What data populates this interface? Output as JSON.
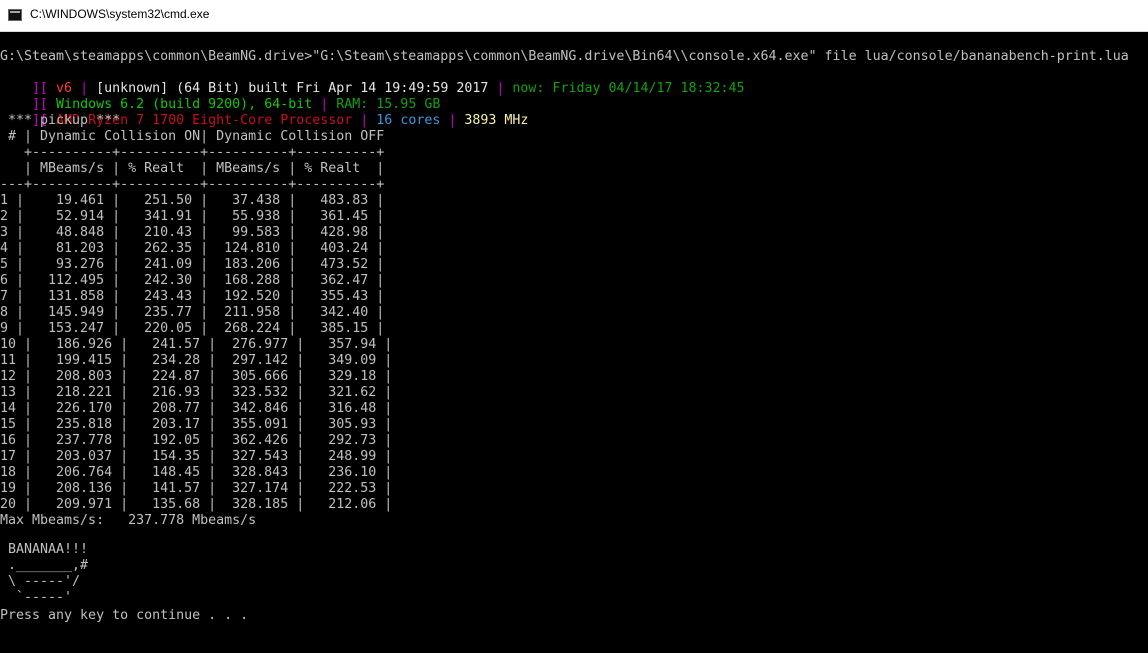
{
  "window": {
    "title": "C:\\WINDOWS\\system32\\cmd.exe",
    "minimize": "—",
    "maximize": "☐",
    "close": "✕"
  },
  "console": {
    "command": "G:\\Steam\\steamapps\\common\\BeamNG.drive>\"G:\\Steam\\steamapps\\common\\BeamNG.drive\\Bin64\\\\console.x64.exe\" file lua/console/bananabench-print.lua",
    "info1": {
      "prefix": "][",
      "version": " v6",
      "sep": " | ",
      "build": "[unknown] (64 Bit) built Fri Apr 14 19:49:59 2017",
      "sep2": " | ",
      "now": "now: Friday 04/14/17 18:32:45"
    },
    "info2": {
      "prefix": "][",
      "os": " Windows 6.2 (build 9200), 64-bit",
      "sep": " | ",
      "ram": "RAM: 15.95 GB"
    },
    "info3": {
      "prefix": "][",
      "cpu": " AMD Ryzen 7 1700 Eight-Core Processor",
      "sep": " | ",
      "cores": "16 cores",
      "sep2": " | ",
      "mhz": "3893 MHz"
    },
    "table_lines": [
      " *** pickup ***",
      " # | Dynamic Collision ON| Dynamic Collision OFF",
      "   +----------+----------+----------+----------+",
      "   | MBeams/s | % Realt  | MBeams/s | % Realt  |",
      "---+----------+----------+----------+----------+",
      "1 |    19.461 |   251.50 |   37.438 |   483.83 |",
      "2 |    52.914 |   341.91 |   55.938 |   361.45 |",
      "3 |    48.848 |   210.43 |   99.583 |   428.98 |",
      "4 |    81.203 |   262.35 |  124.810 |   403.24 |",
      "5 |    93.276 |   241.09 |  183.206 |   473.52 |",
      "6 |   112.495 |   242.30 |  168.288 |   362.47 |",
      "7 |   131.858 |   243.43 |  192.520 |   355.43 |",
      "8 |   145.949 |   235.77 |  211.958 |   342.40 |",
      "9 |   153.247 |   220.05 |  268.224 |   385.15 |",
      "10 |   186.926 |   241.57 |  276.977 |   357.94 |",
      "11 |   199.415 |   234.28 |  297.142 |   349.09 |",
      "12 |   208.803 |   224.87 |  305.666 |   329.18 |",
      "13 |   218.221 |   216.93 |  323.532 |   321.62 |",
      "14 |   226.170 |   208.77 |  342.846 |   316.48 |",
      "15 |   235.818 |   203.17 |  355.091 |   305.93 |",
      "16 |   237.778 |   192.05 |  362.426 |   292.73 |",
      "17 |   203.037 |   154.35 |  327.543 |   248.99 |",
      "18 |   206.764 |   148.45 |  328.843 |   236.10 |",
      "19 |   208.136 |   141.57 |  327.174 |   222.53 |",
      "20 |   209.971 |   135.68 |  328.185 |   212.06 |",
      "Max Mbeams/s:   237.778 Mbeams/s"
    ],
    "banana_lines": [
      " BANANAA!!!",
      " ._______,#",
      " \\ -----'/",
      "  `-----'"
    ],
    "prompt": "Press any key to continue . . ."
  }
}
